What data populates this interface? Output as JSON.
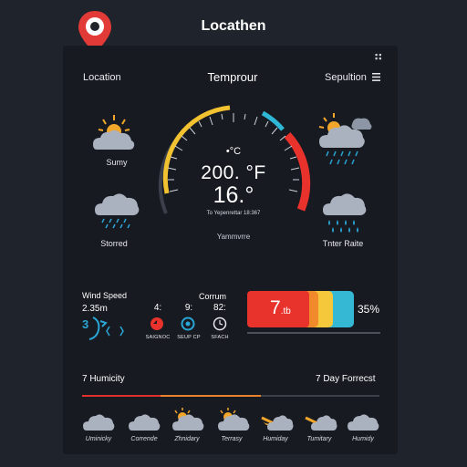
{
  "app_title": "Locathen",
  "header": {
    "left_label": "Location",
    "center_title": "Temprour",
    "right_label": "Sepultion"
  },
  "left_weather": [
    {
      "label": "Sumy",
      "icon": "sun-cloud-icon"
    },
    {
      "label": "Storred",
      "icon": "rain-cloud-icon"
    }
  ],
  "right_weather": [
    {
      "label": "",
      "icon": "storm-cloud-icon"
    },
    {
      "label": "Tnter Raite",
      "icon": "rain-cloud-icon"
    }
  ],
  "gauge": {
    "unit_line": "•°C",
    "value_line1": "200. °F",
    "value_line2": "16.°",
    "small_line": "To Yepenrettar 18:367",
    "caption": "Yammvrre"
  },
  "wind": {
    "label": "Wind Speed",
    "value": "2.35m"
  },
  "column_label": "Corrum",
  "stats": [
    {
      "value": "4:",
      "caption": "SAIGNOC"
    },
    {
      "value": "9:",
      "caption": "SEUP CP"
    },
    {
      "value": "82:",
      "caption": "SFACH"
    }
  ],
  "bar": {
    "main_text": "7",
    "suffix_text": ".tb",
    "percent": "35%",
    "segments": [
      "#e8332c",
      "#f08a2b",
      "#f4c83a",
      "#35b8d4"
    ]
  },
  "bottom": {
    "left_title": "7 Humicity",
    "right_title": "7 Day Forrecst"
  },
  "forecast": [
    {
      "label": "Uminicky",
      "icon": "cloud-icon"
    },
    {
      "label": "Corrende",
      "icon": "cloud-icon"
    },
    {
      "label": "Zhnidary",
      "icon": "sun-cloud-icon"
    },
    {
      "label": "Terrasy",
      "icon": "sun-cloud-icon"
    },
    {
      "label": "Humiday",
      "icon": "moon-cloud-icon"
    },
    {
      "label": "Tumitary",
      "icon": "moon-cloud-icon"
    },
    {
      "label": "Humidy",
      "icon": "cloud-icon"
    }
  ],
  "colors": {
    "background": "#1f232b",
    "panel": "#171a21",
    "gauge_yellow": "#f2c230",
    "gauge_blue": "#2fb7d6",
    "gauge_red": "#e8322b",
    "accent_blue": "#2aa6d6"
  }
}
